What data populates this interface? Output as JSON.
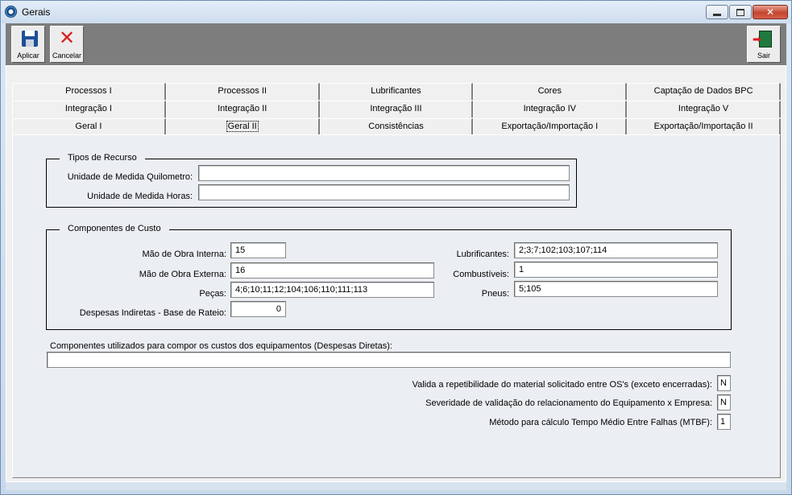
{
  "window": {
    "title": "Gerais"
  },
  "toolbar": {
    "apply": "Aplicar",
    "cancel": "Cancelar",
    "exit": "Sair"
  },
  "tabs": {
    "row1": [
      "Processos I",
      "Processos II",
      "Lubrificantes",
      "Cores",
      "Captação de Dados BPC"
    ],
    "row2": [
      "Integração I",
      "Integração II",
      "Integração III",
      "Integração IV",
      "Integração V"
    ],
    "row3": [
      "Geral I",
      "Geral II",
      "Consistências",
      "Exportação/Importação I",
      "Exportação/Importação II"
    ],
    "active": "Geral II"
  },
  "tipos_recurso": {
    "title": "Tipos de Recurso",
    "km_label": "Unidade de Medida Quilometro:",
    "km_value": "",
    "horas_label": "Unidade de Medida Horas:",
    "horas_value": ""
  },
  "componentes_custo": {
    "title": "Componentes de Custo",
    "mao_interna_label": "Mão de Obra Interna:",
    "mao_interna_value": "15",
    "mao_externa_label": "Mão de Obra Externa:",
    "mao_externa_value": "16",
    "pecas_label": "Peças:",
    "pecas_value": "4;6;10;11;12;104;106;110;111;113",
    "despesas_label": "Despesas Indiretas - Base de Rateio:",
    "despesas_value": "0",
    "lubrificantes_label": "Lubrificantes:",
    "lubrificantes_value": "2;3;7;102;103;107;114",
    "combustiveis_label": "Combustíveis:",
    "combustiveis_value": "1",
    "pneus_label": "Pneus:",
    "pneus_value": "5;105"
  },
  "despesas_diretas": {
    "label": "Componentes utilizados para compor os custos dos equipamentos (Despesas Diretas):",
    "value": ""
  },
  "options": {
    "repetibilidade_label": "Valida a repetibilidade do material solicitado entre OS's (exceto encerradas):",
    "repetibilidade_value": "N",
    "severidade_label": "Severidade de validação do relacionamento do Equipamento x Empresa:",
    "severidade_value": "N",
    "mtbf_label": "Método para cálculo Tempo Médio Entre Falhas (MTBF):",
    "mtbf_value": "1"
  }
}
